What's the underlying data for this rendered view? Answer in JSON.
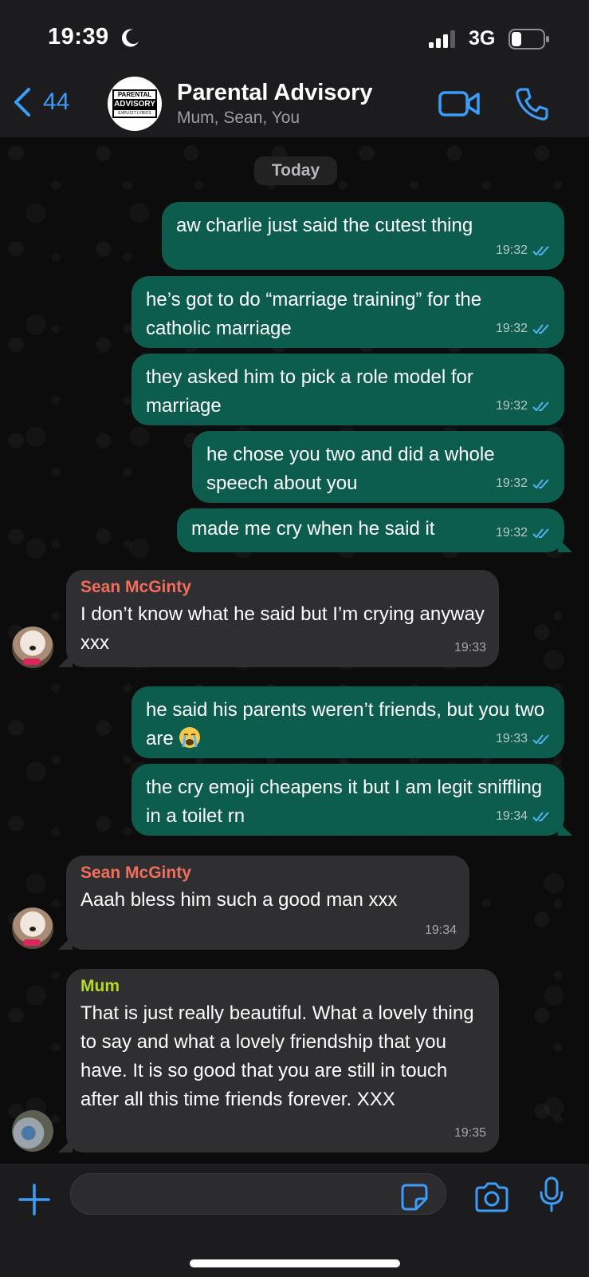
{
  "status_bar": {
    "time": "19:39",
    "network": "3G"
  },
  "header": {
    "back_count": "44",
    "avatar_logo": {
      "top": "PARENTAL",
      "mid": "ADVISORY",
      "bottom": "EXPLICIT LYRICS"
    },
    "title": "Parental Advisory",
    "subtitle": "Mum, Sean, You"
  },
  "date_chip": "Today",
  "messages": [
    {
      "from": "You",
      "text": "aw charlie just said the cutest thing",
      "time": "19:32"
    },
    {
      "from": "You",
      "text": "he’s got to do “marriage training” for the catholic marriage",
      "time": "19:32"
    },
    {
      "from": "You",
      "text": "they asked him to pick a role model for marriage",
      "time": "19:32"
    },
    {
      "from": "You",
      "text": "he chose you two and did a whole speech about you",
      "time": "19:32"
    },
    {
      "from": "You",
      "text": "made me cry when he said it",
      "time": "19:32"
    },
    {
      "from": "Sean McGinty",
      "text": "I don’t know what he said but I’m crying anyway xxx",
      "time": "19:33"
    },
    {
      "from": "You",
      "text": "he said his parents weren’t friends, but you two are",
      "time": "19:33"
    },
    {
      "from": "You",
      "text": "the cry emoji cheapens it but I am legit sniffling in a toilet rn",
      "time": "19:34"
    },
    {
      "from": "Sean McGinty",
      "text": "Aaah bless him such a good man xxx",
      "time": "19:34"
    },
    {
      "from": "Mum",
      "text": "That is just really beautiful. What a lovely thing to say and what a lovely friendship that you have. It is so good that you are still in touch after all this time friends forever. XXX",
      "time": "19:35"
    }
  ],
  "colors": {
    "outgoing_bubble": "#0c5d4d",
    "incoming_bubble": "#2f2f31",
    "accent": "#3b9df8",
    "sean_name": "#f26d5b",
    "mum_name": "#b5d92b"
  },
  "composer": {
    "value": ""
  }
}
